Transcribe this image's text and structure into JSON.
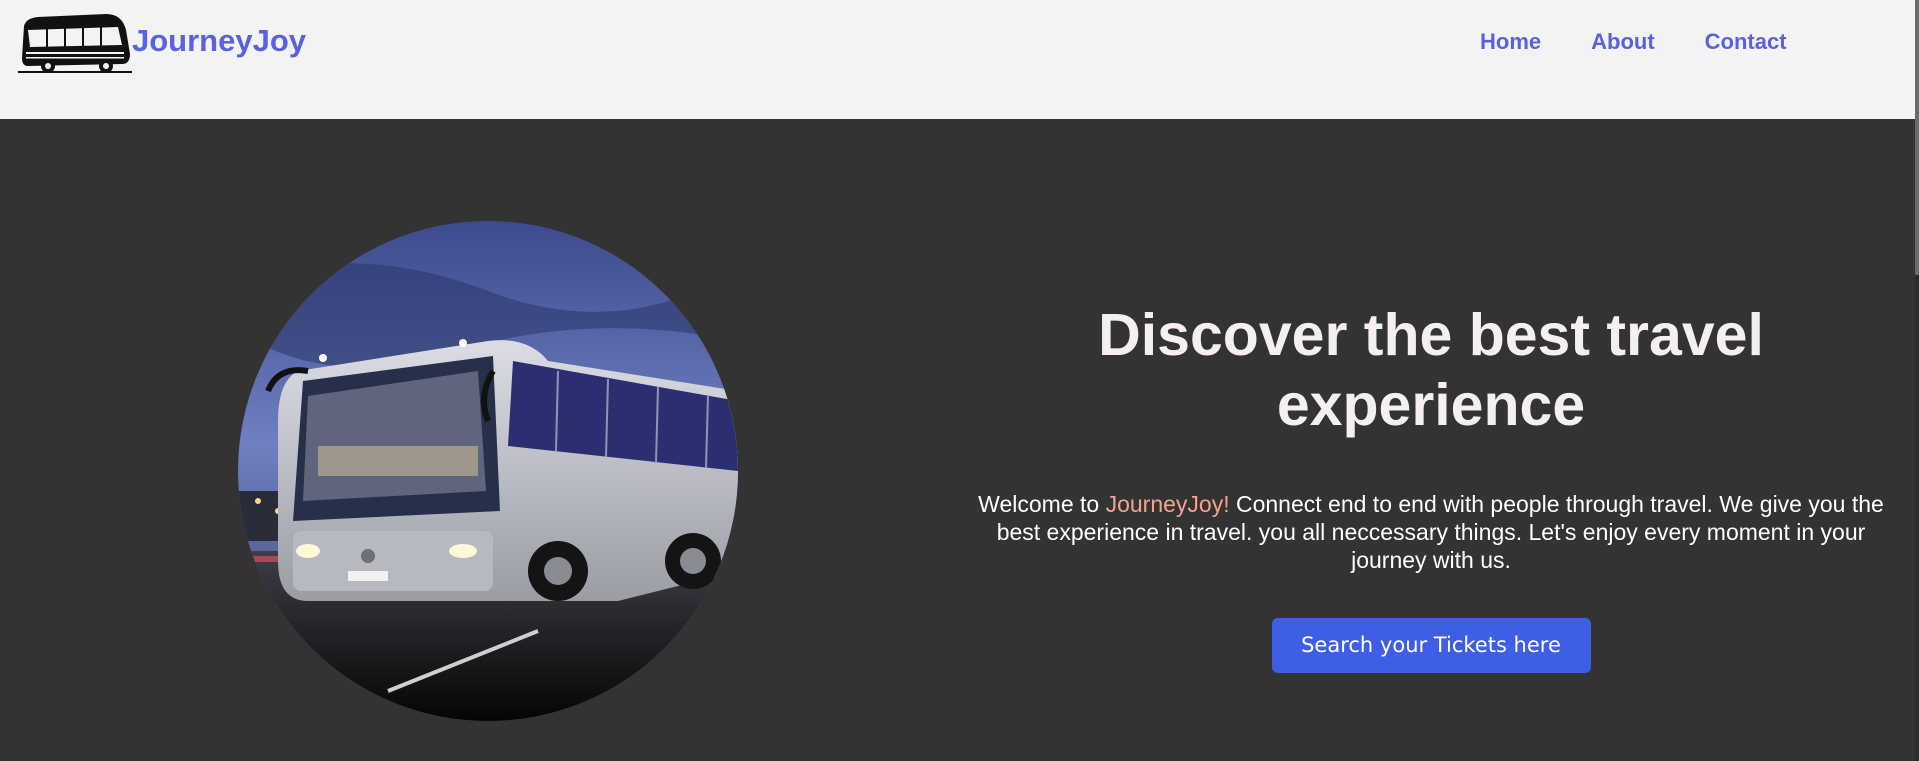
{
  "brand": {
    "name": "JourneyJoy",
    "logo_icon": "bus-logo-icon"
  },
  "nav": {
    "links": [
      {
        "label": "Home"
      },
      {
        "label": "About"
      },
      {
        "label": "Contact"
      }
    ]
  },
  "hero": {
    "image_icon": "bus-photo",
    "title": "Discover the best travel experience",
    "intro_prefix": "Welcome to ",
    "intro_highlight": "JourneyJoy!",
    "intro_rest": " Connect end to end with people through travel. We give you the best experience in travel. you all neccessary things. Let's enjoy every moment in your journey with us.",
    "cta_label": "Search your Tickets here"
  },
  "colors": {
    "brand": "#5b62e0",
    "background": "#333333",
    "navbar": "#f3f3f3",
    "highlight": "#f3a48e",
    "cta": "#3f5ee6"
  }
}
